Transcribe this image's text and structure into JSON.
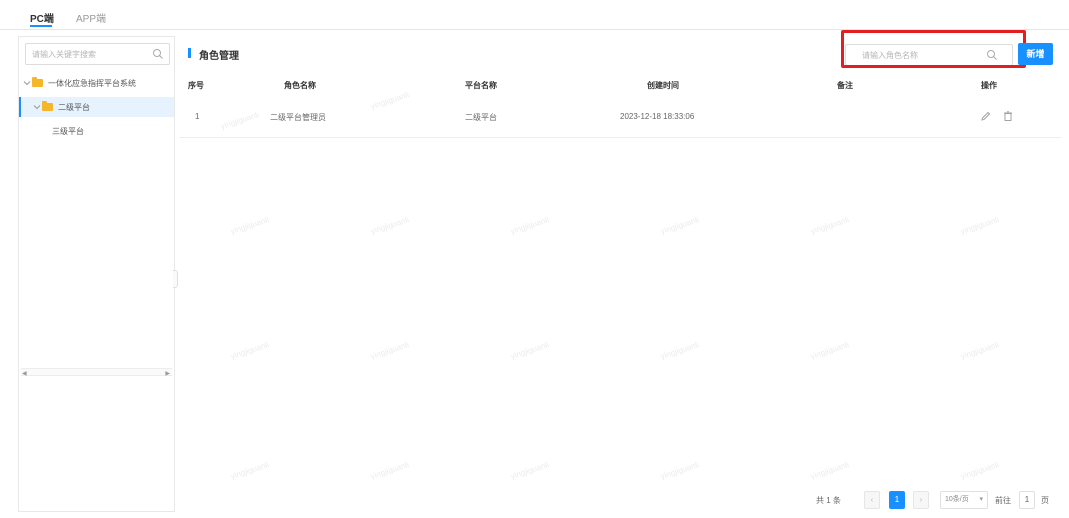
{
  "tabs": [
    {
      "label": "PC端",
      "active": true
    },
    {
      "label": "APP端",
      "active": false
    }
  ],
  "sidebar": {
    "search_placeholder": "请输入关键字搜索",
    "tree": [
      {
        "label": "一体化应急指挥平台系统",
        "level": 0,
        "icon": "folder-icon",
        "expanded": true
      },
      {
        "label": "二级平台",
        "level": 1,
        "icon": "folder-icon",
        "expanded": true,
        "selected": true
      },
      {
        "label": "三级平台",
        "level": 2
      }
    ]
  },
  "main": {
    "title": "角色管理",
    "search_placeholder": "请输入角色名称",
    "add_label": "新增",
    "columns": [
      "序号",
      "角色名称",
      "平台名称",
      "创建时间",
      "备注",
      "操作"
    ],
    "rows": [
      {
        "index": "1",
        "name": "二级平台管理员",
        "platform": "二级平台",
        "created": "2023-12-18 18:33:06",
        "remark": ""
      }
    ],
    "watermark": "yingjiguanli"
  },
  "pagination": {
    "total": "共 1 条",
    "current_page": "1",
    "page_size": "10条/页",
    "goto_prefix": "前往",
    "goto_value": "1",
    "goto_suffix": "页"
  },
  "colors": {
    "accent": "#1890ff",
    "highlight": "#e02020",
    "folder": "#f5b729"
  }
}
